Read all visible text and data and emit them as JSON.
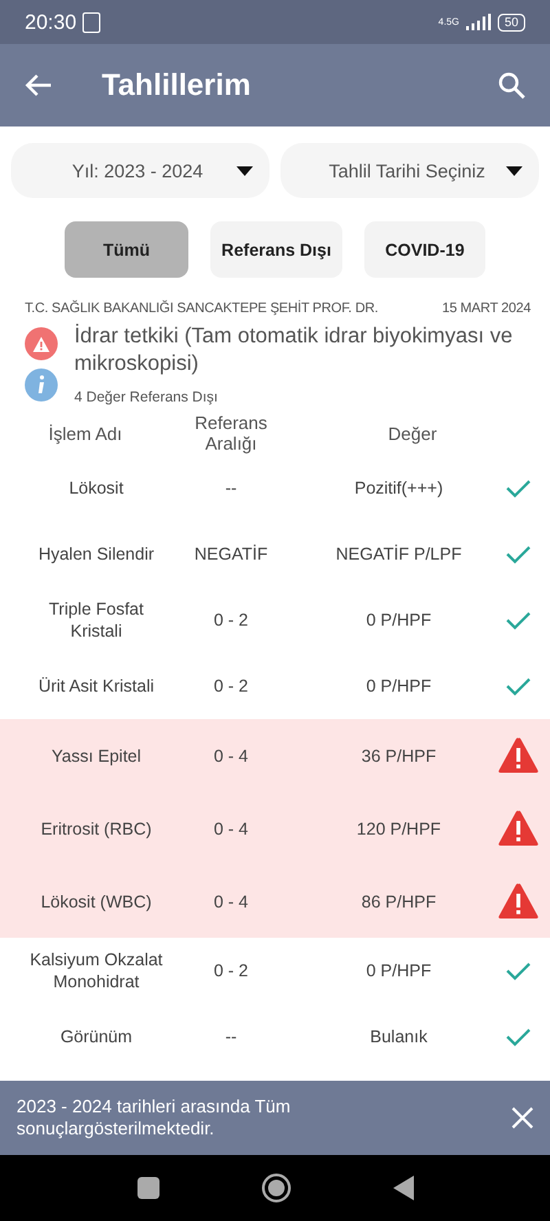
{
  "status_bar": {
    "time": "20:30",
    "battery": "50",
    "network": "4.5G"
  },
  "app_bar": {
    "title": "Tahlillerim"
  },
  "filters": [
    {
      "label": "Yıl: 2023 - 2024"
    },
    {
      "label": "Tahlil Tarihi Seçiniz"
    }
  ],
  "tabs": [
    {
      "label": "Tümü",
      "selected": true
    },
    {
      "label": "Referans Dışı",
      "selected": false
    },
    {
      "label": "COVID-19",
      "selected": false
    }
  ],
  "report": {
    "hospital": "T.C. SAĞLIK BAKANLIĞI SANCAKTEPE ŞEHİT PROF. DR.",
    "date": "15 MART 2024",
    "title": "İdrar tetkiki (Tam otomatik idrar biyokimyası ve mikroskopisi)",
    "summary": "4 Değer Referans Dışı"
  },
  "table": {
    "columns": [
      "İşlem Adı",
      "Referans Aralığı",
      "Değer"
    ],
    "rows": [
      {
        "name": "Lökosit",
        "range": "--",
        "value": "Pozitif(+++)",
        "kind": "normal"
      },
      {
        "name": "Hyalen Silendir",
        "range": "NEGATİF",
        "value": "NEGATİF P/LPF",
        "kind": "normal"
      },
      {
        "name": "Triple Fosfat Kristali",
        "range": "0 - 2",
        "value": "0 P/HPF",
        "kind": "normal"
      },
      {
        "name": "Ürit Asit Kristali",
        "range": "0 - 2",
        "value": "0 P/HPF",
        "kind": "normal"
      },
      {
        "name": "Yassı Epitel",
        "range": "0 - 4",
        "value": "36 P/HPF",
        "kind": "abnormal"
      },
      {
        "name": "Eritrosit (RBC)",
        "range": "0 - 4",
        "value": "120 P/HPF",
        "kind": "abnormal"
      },
      {
        "name": "Lökosit (WBC)",
        "range": "0 - 4",
        "value": "86 P/HPF",
        "kind": "abnormal"
      },
      {
        "name": "Kalsiyum Okzalat Monohidrat",
        "range": "0 - 2",
        "value": "0 P/HPF",
        "kind": "normal"
      },
      {
        "name": "Görünüm",
        "range": "--",
        "value": "Bulanık",
        "kind": "normal"
      }
    ]
  },
  "snackbar": {
    "message": "2023 - 2024 tarihleri arasında Tüm sonuçlargösterilmektedir."
  }
}
